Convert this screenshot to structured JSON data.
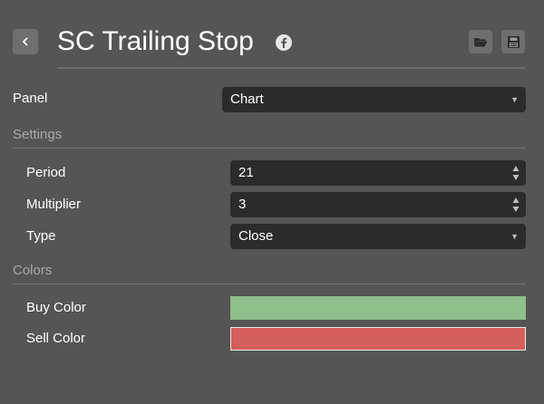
{
  "header": {
    "title": "SC Trailing Stop",
    "icons": {
      "back": "chevron-left-icon",
      "social": "facebook-icon",
      "open": "folder-open-icon",
      "save": "floppy-disk-icon"
    }
  },
  "panel": {
    "label": "Panel",
    "value": "Chart"
  },
  "settings": {
    "title": "Settings",
    "period": {
      "label": "Period",
      "value": "21"
    },
    "multiplier": {
      "label": "Multiplier",
      "value": "3"
    },
    "type": {
      "label": "Type",
      "value": "Close"
    }
  },
  "colors": {
    "title": "Colors",
    "buy": {
      "label": "Buy Color",
      "color": "#8fbf8a"
    },
    "sell": {
      "label": "Sell Color",
      "color": "#d55f5c"
    }
  },
  "theme": {
    "background": "#555555",
    "field_background": "#2b2b2b",
    "section_text": "#a9a9a9"
  }
}
